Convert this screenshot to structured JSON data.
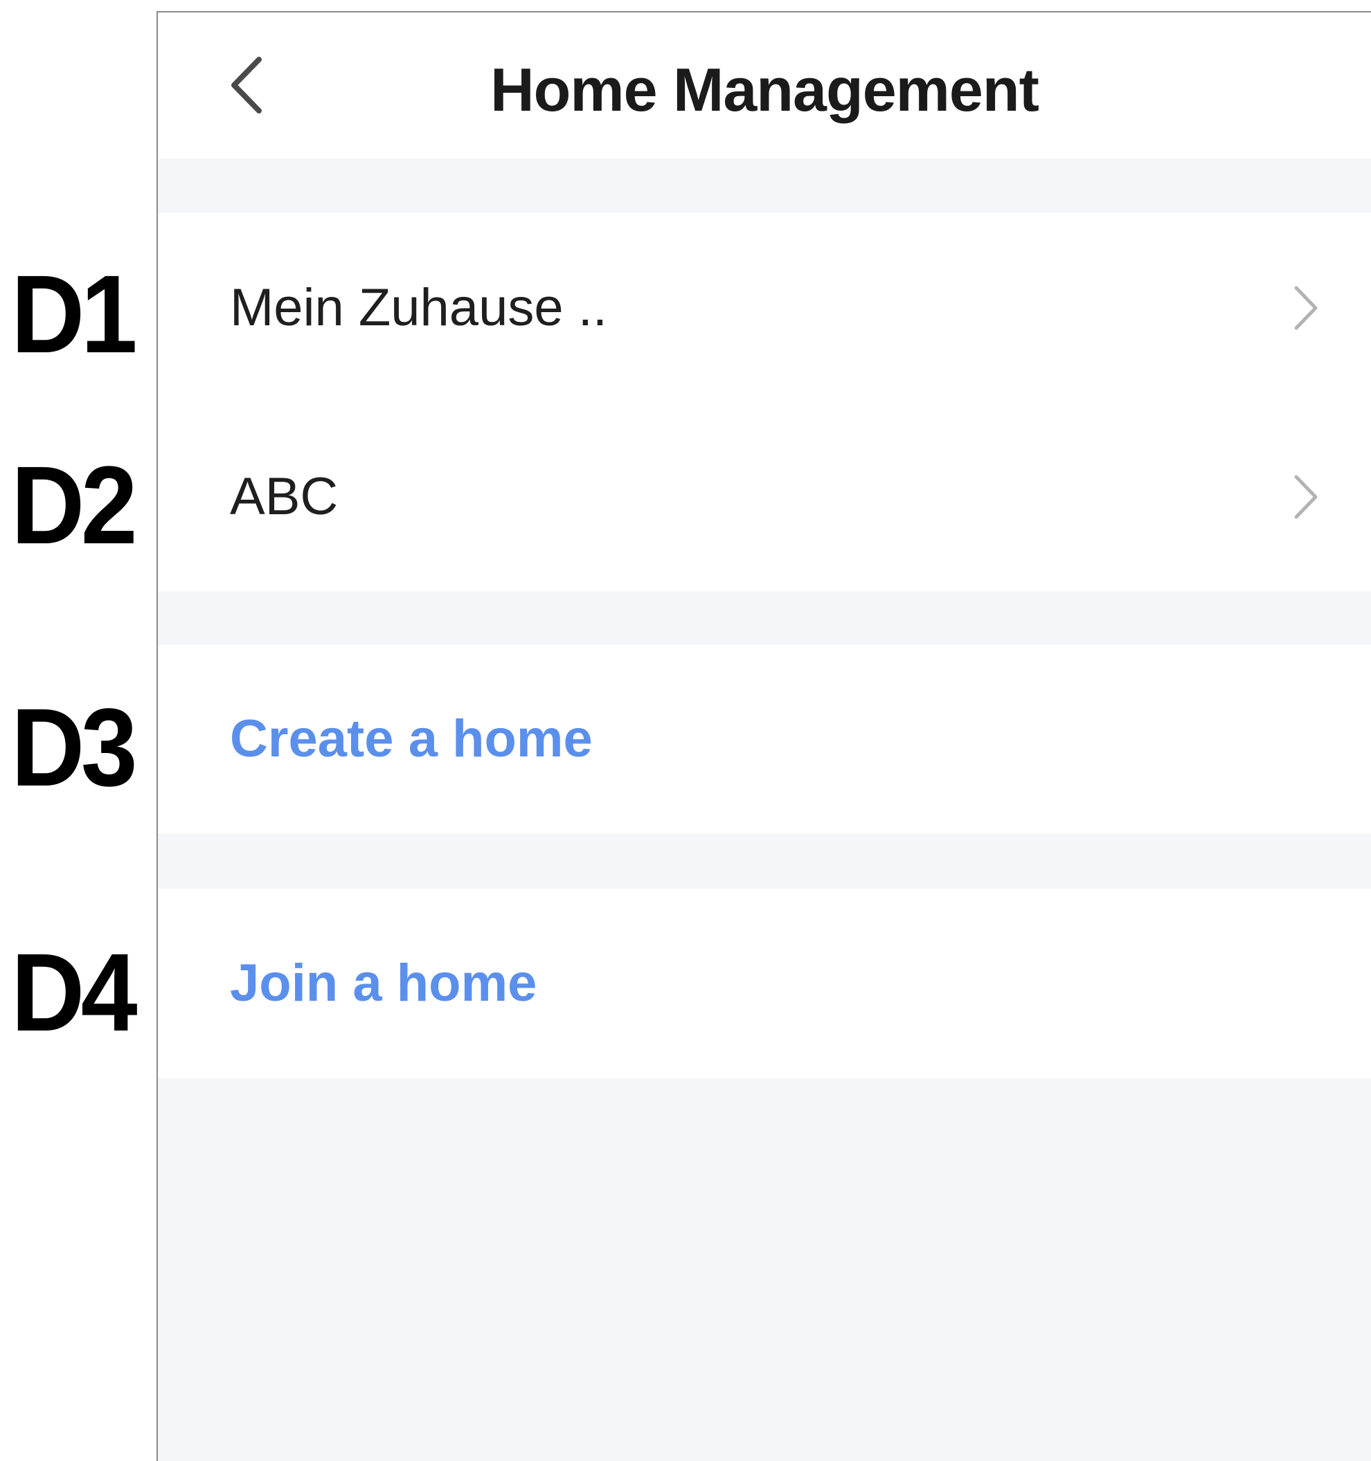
{
  "annotations": {
    "d1": "D1",
    "d2": "D2",
    "d3": "D3",
    "d4": "D4"
  },
  "header": {
    "back_icon": "chevron-left-icon",
    "title": "Home Management"
  },
  "homes": [
    {
      "name": "Mein Zuhause ..",
      "icon": "chevron-right-icon"
    },
    {
      "name": "ABC",
      "icon": "chevron-right-icon"
    }
  ],
  "actions": {
    "create_label": "Create a home",
    "join_label": "Join a home"
  },
  "colors": {
    "accent": "#5b8fec",
    "background": "#f5f6fa",
    "card": "#ffffff",
    "text": "#1f1f1f",
    "chevron": "#b3b3b3"
  }
}
